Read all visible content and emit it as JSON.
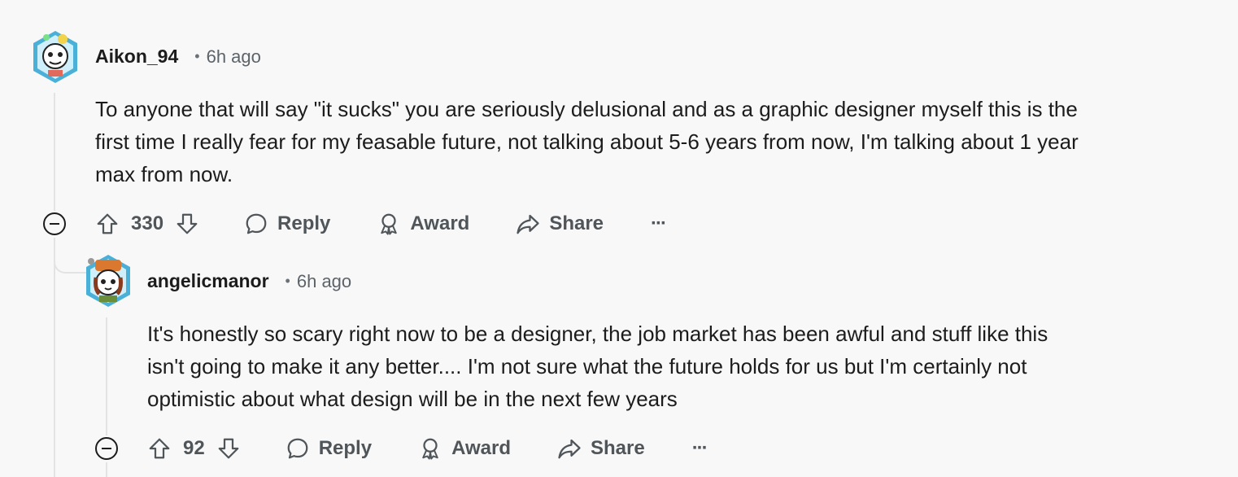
{
  "comments": [
    {
      "username": "Aikon_94",
      "separator": "•",
      "time": "6h ago",
      "body": [
        "To anyone that will say \"it sucks\" you are seriously delusional and as a graphic designer myself this is the",
        "first time I really fear for my feasable future, not talking about 5-6 years from now, I'm talking about 1 year",
        "max from now."
      ],
      "score": "330",
      "reply_label": "Reply",
      "award_label": "Award",
      "share_label": "Share",
      "more_label": "···"
    },
    {
      "username": "angelicmanor",
      "separator": "•",
      "time": "6h ago",
      "body": [
        "It's honestly so scary right now to be a designer, the job market has been awful and stuff like this",
        "isn't going to make it any better.... I'm not sure what the future holds for us but I'm certainly not",
        "optimistic about what design will be in the next few years"
      ],
      "score": "92",
      "reply_label": "Reply",
      "award_label": "Award",
      "share_label": "Share",
      "more_label": "···"
    }
  ],
  "colors": {
    "background": "#f8f8f8",
    "text": "#1c1c1c",
    "muted": "#5c6369",
    "thread_line": "#e3e3e3"
  }
}
